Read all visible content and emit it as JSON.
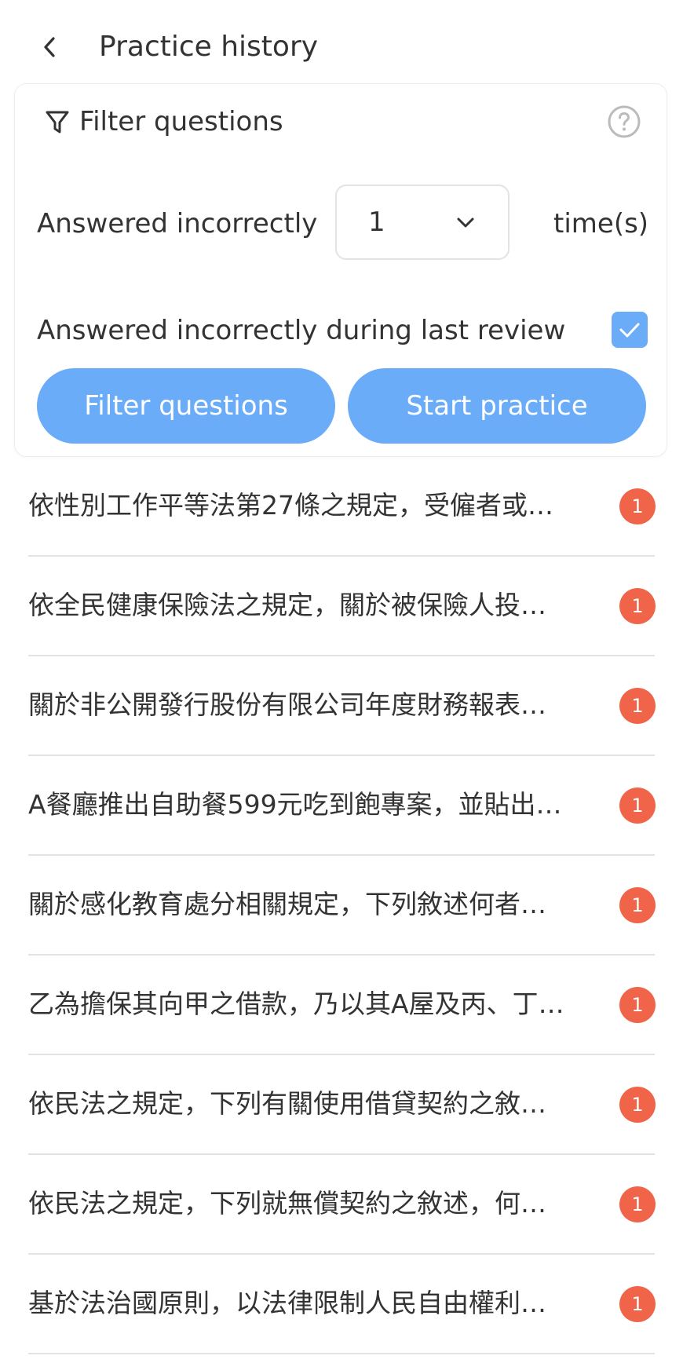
{
  "header": {
    "title": "Practice history",
    "back_icon": "chevron-left-icon"
  },
  "filter_card": {
    "title": "Filter questions",
    "filter_icon": "funnel-icon",
    "help_icon": "question-circle-icon",
    "incorrect_label": "Answered incorrectly",
    "incorrect_count_selected": "1",
    "times_label": "time(s)",
    "last_review_label": "Answered incorrectly during last review",
    "last_review_checked": true,
    "filter_button_label": "Filter questions",
    "start_button_label": "Start practice"
  },
  "colors": {
    "accent": "#6aacf8",
    "badge": "#f0654a",
    "text": "#333333",
    "divider": "#e3e3e3"
  },
  "questions": [
    {
      "text": "依性別工作平等法第27條之規定，受僱者或…",
      "count": "1"
    },
    {
      "text": "依全民健康保險法之規定，關於被保險人投…",
      "count": "1"
    },
    {
      "text": "關於非公開發行股份有限公司年度財務報表…",
      "count": "1"
    },
    {
      "text": "A餐廳推出自助餐599元吃到飽專案，並貼出…",
      "count": "1"
    },
    {
      "text": "關於感化教育處分相關規定，下列敘述何者…",
      "count": "1"
    },
    {
      "text": "乙為擔保其向甲之借款，乃以其A屋及丙、丁…",
      "count": "1"
    },
    {
      "text": "依民法之規定，下列有關使用借貸契約之敘…",
      "count": "1"
    },
    {
      "text": "依民法之規定，下列就無償契約之敘述，何…",
      "count": "1"
    },
    {
      "text": "基於法治國原則，以法律限制人民自由權利…",
      "count": "1"
    }
  ]
}
